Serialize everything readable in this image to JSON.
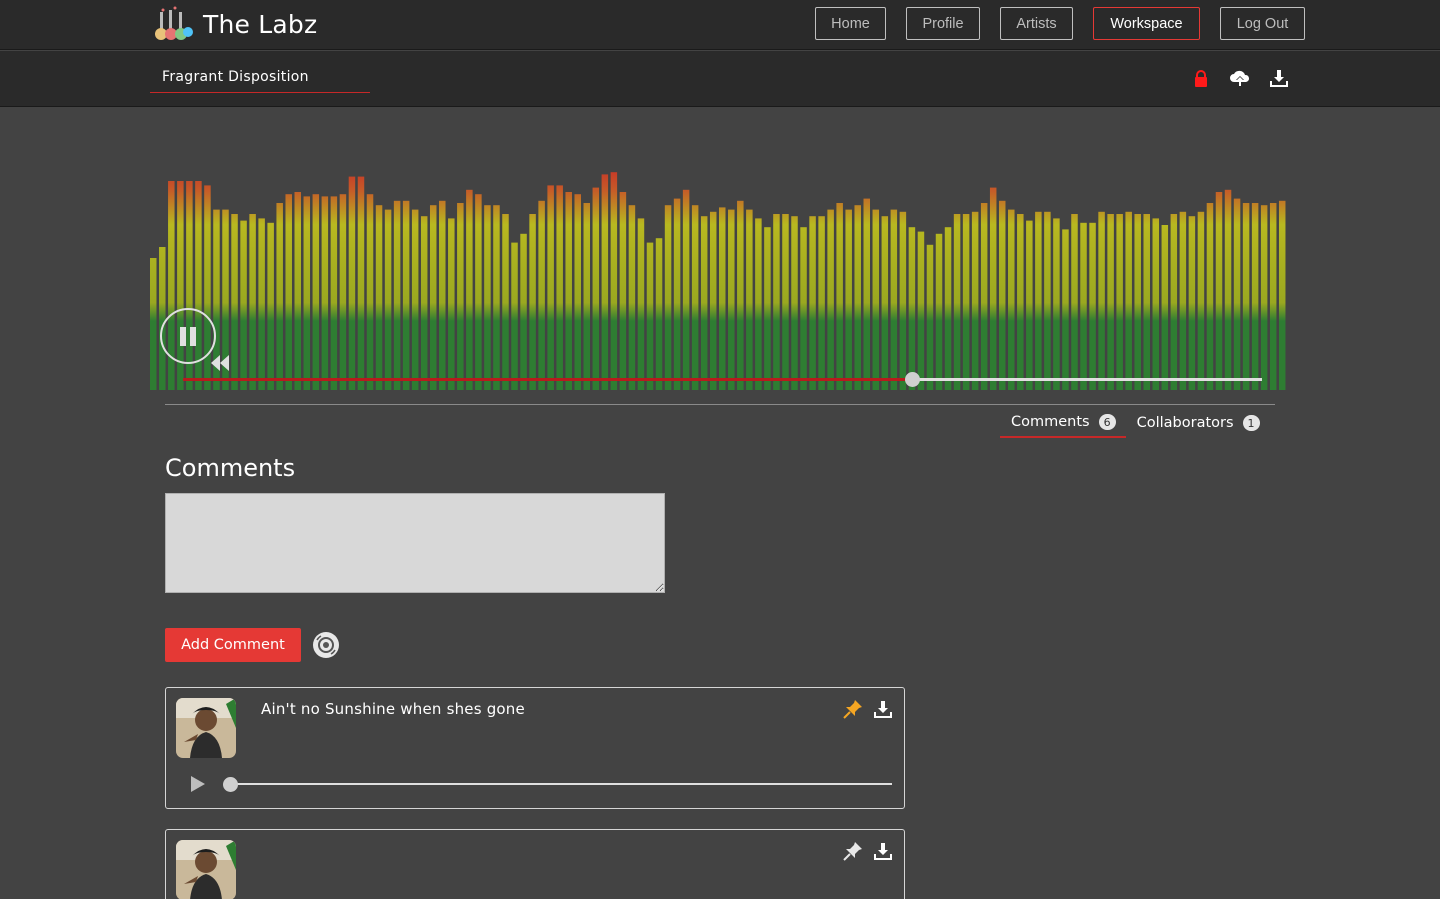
{
  "app": {
    "name": "The Labz"
  },
  "nav": {
    "items": [
      {
        "label": "Home",
        "active": false
      },
      {
        "label": "Profile",
        "active": false
      },
      {
        "label": "Artists",
        "active": false
      },
      {
        "label": "Workspace",
        "active": true
      },
      {
        "label": "Log Out",
        "active": false
      }
    ]
  },
  "project": {
    "name": "Fragrant Disposition",
    "icons": [
      "lock-icon",
      "cloud-upload-icon",
      "download-icon"
    ]
  },
  "player": {
    "state": "playing",
    "progress": 0.676,
    "levels": [
      0.6,
      0.65,
      0.95,
      0.95,
      0.95,
      0.95,
      0.93,
      0.82,
      0.82,
      0.8,
      0.77,
      0.8,
      0.78,
      0.76,
      0.85,
      0.89,
      0.9,
      0.88,
      0.89,
      0.88,
      0.88,
      0.89,
      0.97,
      0.97,
      0.89,
      0.84,
      0.82,
      0.86,
      0.86,
      0.82,
      0.79,
      0.84,
      0.86,
      0.78,
      0.85,
      0.91,
      0.89,
      0.84,
      0.84,
      0.8,
      0.67,
      0.71,
      0.8,
      0.86,
      0.93,
      0.93,
      0.9,
      0.89,
      0.85,
      0.92,
      0.98,
      0.99,
      0.9,
      0.84,
      0.78,
      0.67,
      0.69,
      0.84,
      0.87,
      0.91,
      0.84,
      0.79,
      0.81,
      0.83,
      0.82,
      0.86,
      0.82,
      0.78,
      0.74,
      0.8,
      0.8,
      0.79,
      0.74,
      0.79,
      0.79,
      0.82,
      0.85,
      0.82,
      0.84,
      0.87,
      0.82,
      0.79,
      0.82,
      0.81,
      0.74,
      0.72,
      0.66,
      0.71,
      0.74,
      0.8,
      0.8,
      0.81,
      0.85,
      0.92,
      0.86,
      0.82,
      0.8,
      0.77,
      0.81,
      0.81,
      0.78,
      0.73,
      0.8,
      0.76,
      0.76,
      0.81,
      0.8,
      0.8,
      0.81,
      0.8,
      0.8,
      0.78,
      0.75,
      0.8,
      0.81,
      0.79,
      0.81,
      0.85,
      0.9,
      0.91,
      0.87,
      0.85,
      0.85,
      0.84,
      0.85,
      0.86
    ]
  },
  "tabs": [
    {
      "label": "Comments",
      "count": "6",
      "active": true
    },
    {
      "label": "Collaborators",
      "count": "1",
      "active": false
    }
  ],
  "comments": {
    "title": "Comments",
    "input_value": "",
    "add_label": "Add Comment",
    "items": [
      {
        "text": "Ain't no Sunshine when shes gone",
        "pinned": true,
        "has_audio": true
      },
      {
        "text": "",
        "pinned": false,
        "has_audio": false
      }
    ]
  },
  "colors": {
    "accent": "#e53935",
    "pin_active": "#f5a623",
    "lock": "#ff1a1a",
    "wave_low": "#2e7d32",
    "wave_mid": "#b8b820",
    "wave_high": "#c62828"
  }
}
